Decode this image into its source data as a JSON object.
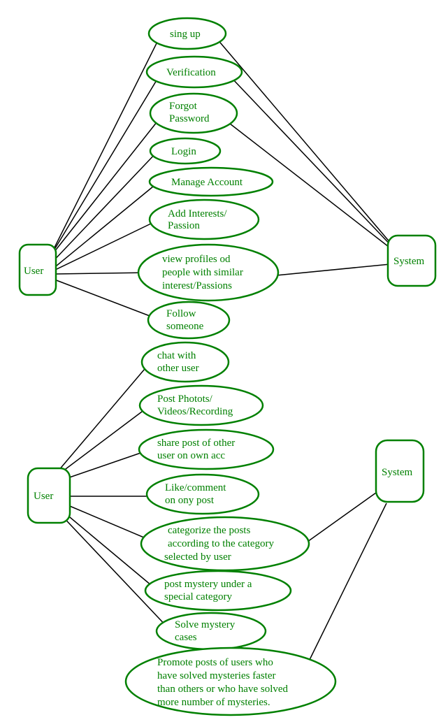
{
  "actors": {
    "user1": "User",
    "user2": "User",
    "system1": "System",
    "system2": "System"
  },
  "usecases": {
    "uc_signup": "sing up",
    "uc_verification": "Verification",
    "uc_forgot1": "Forgot",
    "uc_forgot2": "Password",
    "uc_login": "Login",
    "uc_manage": "Manage Account",
    "uc_add1": "Add Interests/",
    "uc_add2": "Passion",
    "uc_view1": "view profiles od",
    "uc_view2": "people with similar",
    "uc_view3": "interest/Passions",
    "uc_follow1": "Follow",
    "uc_follow2": "someone",
    "uc_chat1": "chat with",
    "uc_chat2": "other user",
    "uc_post1": "Post Photots/",
    "uc_post2": "Videos/Recording",
    "uc_share1": "share post of other",
    "uc_share2": "user on own acc",
    "uc_like1": "Like/comment",
    "uc_like2": "on ony post",
    "uc_cat1": " categorize the posts",
    "uc_cat2": " according to the category",
    "uc_cat3": "selected by user",
    "uc_myst1": "post mystery under a",
    "uc_myst2": "special category",
    "uc_solve1": "Solve mystery",
    "uc_solve2": "   cases",
    "uc_promote1": " Promote posts of users who",
    "uc_promote2": "  have solved mysteries faster",
    "uc_promote3": "  than others or who have solved",
    "uc_promote4": " more number of mysteries."
  }
}
